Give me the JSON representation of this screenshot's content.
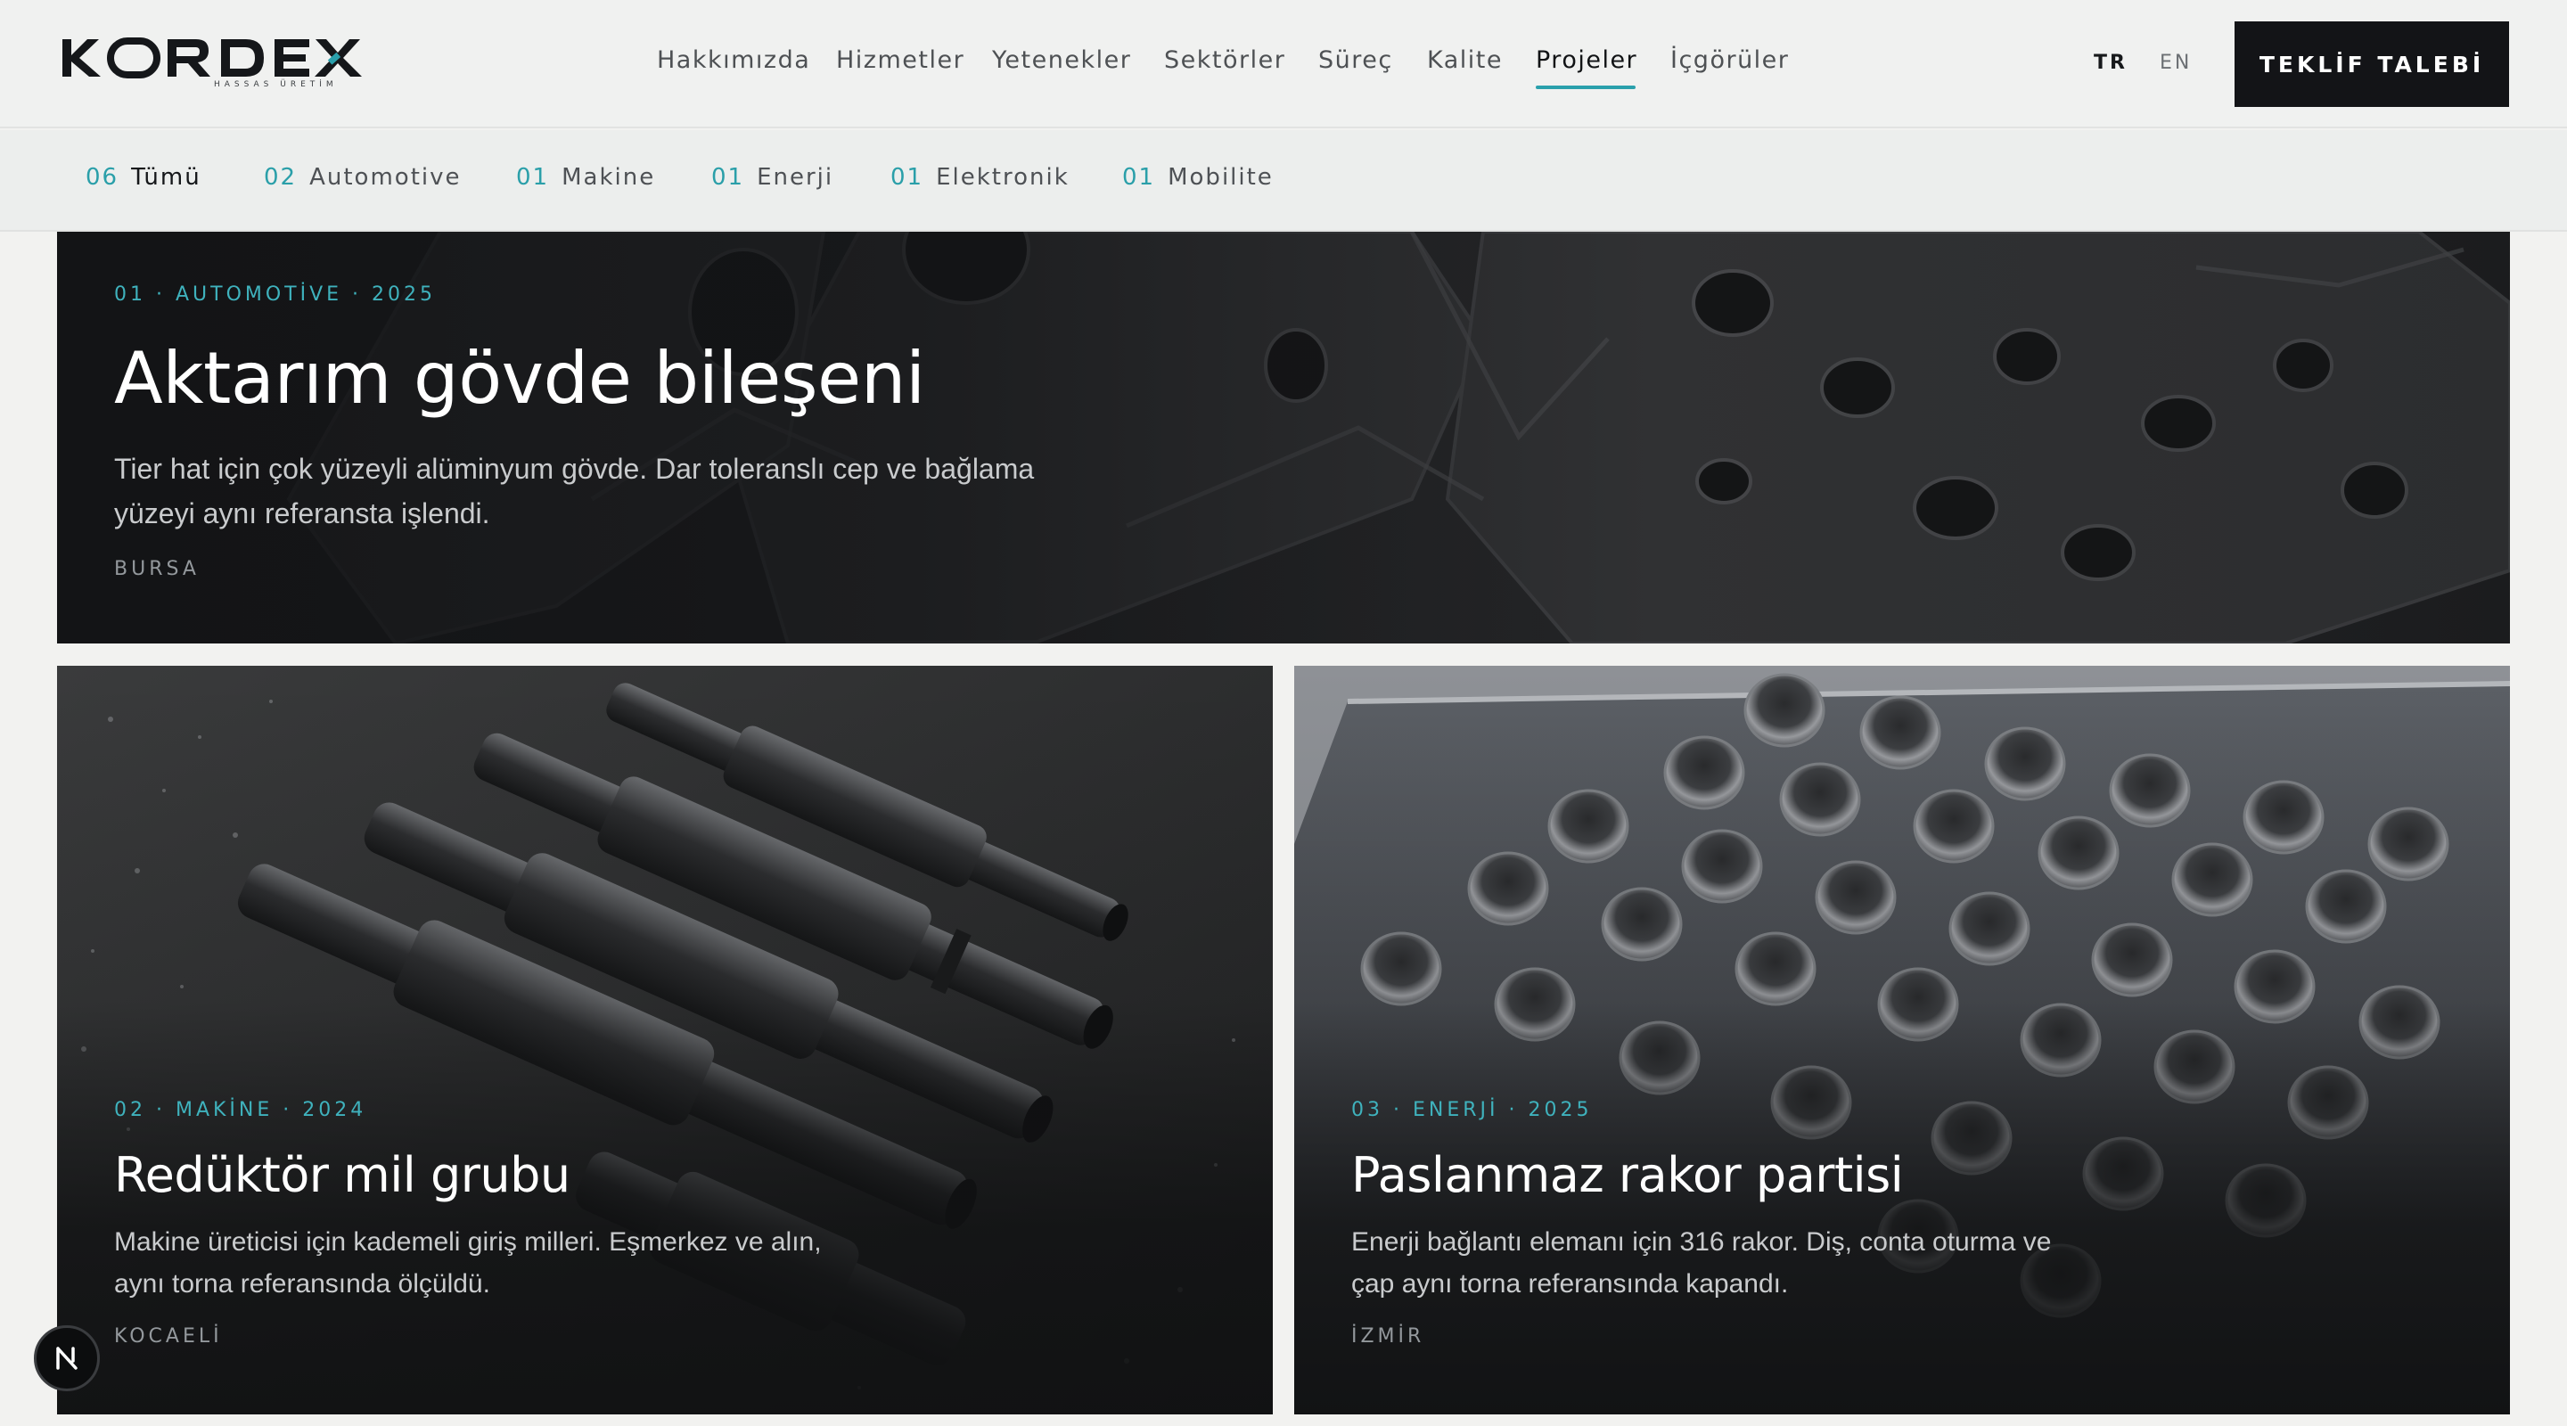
{
  "brand": {
    "name": "KORDEX",
    "tagline": "HASSAS ÜRETİM",
    "accent_color": "#2aa0ac"
  },
  "nav": {
    "items": [
      {
        "label": "Hakkımızda",
        "active": false
      },
      {
        "label": "Hizmetler",
        "active": false
      },
      {
        "label": "Yetenekler",
        "active": false
      },
      {
        "label": "Sektörler",
        "active": false
      },
      {
        "label": "Süreç",
        "active": false
      },
      {
        "label": "Kalite",
        "active": false
      },
      {
        "label": "Projeler",
        "active": true
      },
      {
        "label": "İçgörüler",
        "active": false
      }
    ]
  },
  "language": {
    "options": [
      "TR",
      "EN"
    ],
    "selected": "TR"
  },
  "cta": {
    "label": "TEKLİF TALEBİ"
  },
  "filters": [
    {
      "count": "06",
      "label": "Tümü",
      "active": true
    },
    {
      "count": "02",
      "label": "Automotive",
      "active": false
    },
    {
      "count": "01",
      "label": "Makine",
      "active": false
    },
    {
      "count": "01",
      "label": "Enerji",
      "active": false
    },
    {
      "count": "01",
      "label": "Elektronik",
      "active": false
    },
    {
      "count": "01",
      "label": "Mobilite",
      "active": false
    }
  ],
  "projects": [
    {
      "meta": "01 · AUTOMOTİVE · 2025",
      "title": "Aktarım gövde bileşeni",
      "description": "Tier hat için çok yüzeyli alüminyum gövde. Dar toleranslı cep ve bağlama yüzeyi aynı referansta işlendi.",
      "location": "BURSA",
      "image": "engine-housing-photo"
    },
    {
      "meta": "02 · MAKİNE · 2024",
      "title": "Redüktör mil grubu",
      "description": "Makine üreticisi için kademeli giriş milleri. Eşmerkez ve alın, aynı torna referansında ölçüldü.",
      "location": "KOCAELİ",
      "image": "shafts-photo"
    },
    {
      "meta": "03 · ENERJİ · 2025",
      "title": "Paslanmaz rakor partisi",
      "description": "Enerji bağlantı elemanı için 316 rakor. Diş, conta oturma ve çap aynı torna referansında kapandı.",
      "location": "İZMİR",
      "image": "fittings-tray-photo"
    }
  ],
  "badge": {
    "letter": "N"
  }
}
